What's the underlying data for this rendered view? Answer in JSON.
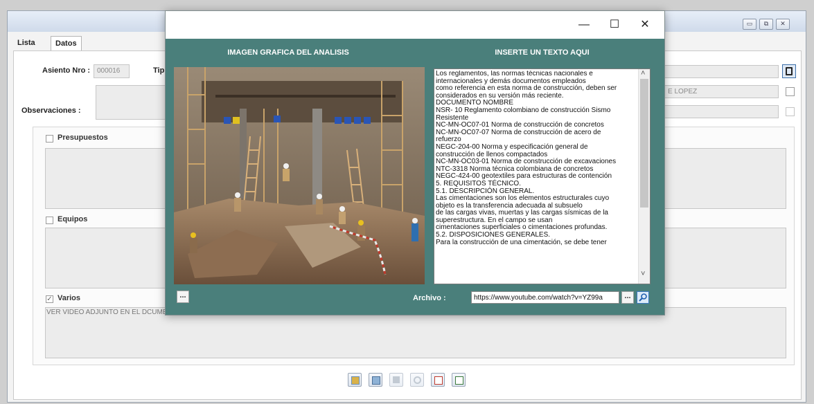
{
  "parent_window": {
    "tabs": [
      "Lista",
      "Datos"
    ],
    "asiento_label": "Asiento Nro :",
    "asiento_value": "000016",
    "tipo_label_partial": "Tip",
    "observaciones_label": "Observaciones :",
    "field_partial_text": "E LOPEZ",
    "groups": {
      "presupuestos": "Presupuestos",
      "equipos": "Equipos",
      "varios": "Varios",
      "varios_text": "VER VIDEO ADJUNTO EN EL DCUMENTO ANEXO"
    },
    "varios_checked": "✓",
    "window_controls": {
      "minimize": "▭",
      "restore": "⧉",
      "close": "✕"
    }
  },
  "dialog": {
    "controls": {
      "minimize": "—",
      "maximize": "☐",
      "close": "✕"
    },
    "left_header": "IMAGEN GRAFICA DEL ANALISIS",
    "right_header": "INSERTE UN TEXTO AQUI",
    "text_content": "Los reglamentos, las normas técnicas nacionales e\ninternacionales y demás documentos empleados\ncomo referencia en esta norma de construcción, deben ser\nconsiderados en su versión más reciente.\nDOCUMENTO NOMBRE\nNSR- 10 Reglamento colombiano de construcción Sismo\nResistente\nNC-MN-OC07-01 Norma de construcción de concretos\nNC-MN-OC07-07 Norma de construcción de acero de\nrefuerzo\nNEGC-204-00 Norma y especificación general de\nconstrucción de llenos compactados\nNC-MN-OC03-01 Norma de construcción de excavaciones\nNTC-3318 Norma técnica colombiana de concretos\nNEGC-424-00 geotextiles para estructuras de contención\n5. REQUISITOS TÉCNICO.\n5.1. DESCRIPCIÓN GENERAL.\nLas cimentaciones son los elementos estructurales cuyo\nobjeto es la transferencia adecuada al subsuelo\nde las cargas vivas, muertas y las cargas sísmicas de la\nsuperestructura. En el campo se usan\ncimentaciones superficiales o cimentaciones profundas.\n5.2. DISPOSICIONES GENERALES.\nPara la construcción de una cimentación, se debe tener",
    "archivo_label": "Archivo :",
    "archivo_value": "https://www.youtube.com/watch?v=YZ99a",
    "browse_label": "...",
    "image_browse_label": "...",
    "scroll_up": "˄",
    "scroll_down": "˅"
  },
  "colors": {
    "dialog_bg": "#4a7f7b",
    "field_bg": "#ececec"
  }
}
